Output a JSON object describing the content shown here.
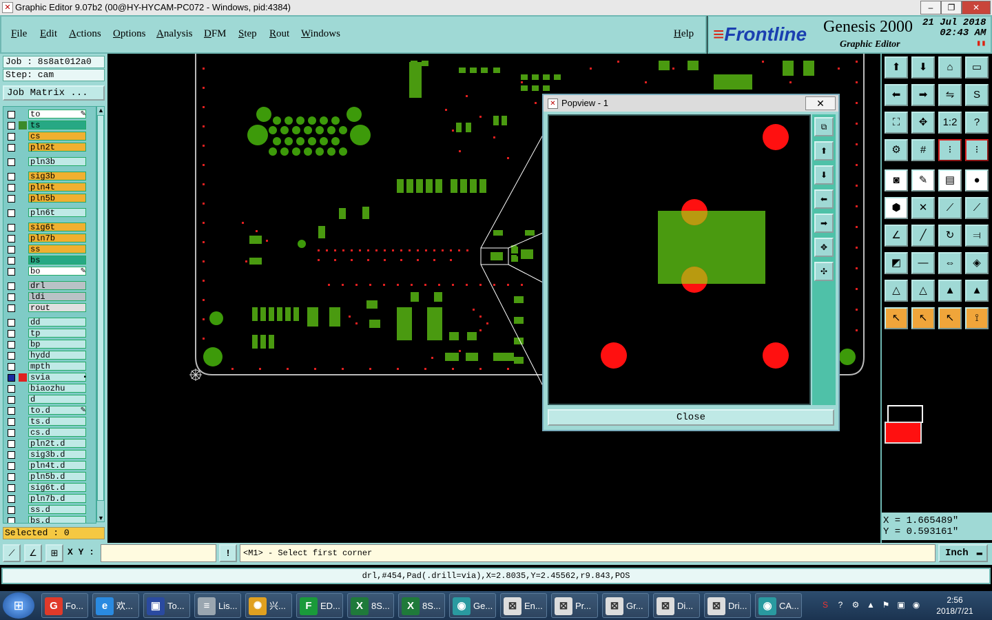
{
  "window": {
    "title": "Graphic Editor 9.07b2 (00@HY-HYCAM-PC072 - Windows, pid:4384)",
    "min": "–",
    "max": "❐",
    "close": "✕"
  },
  "menu": [
    "File",
    "Edit",
    "Actions",
    "Options",
    "Analysis",
    "DFM",
    "Step",
    "Rout",
    "Windows"
  ],
  "help": "Help",
  "brand": {
    "logo": "Frontline",
    "product": "Genesis 2000",
    "subtitle": "Graphic Editor",
    "date": "21 Jul 2018",
    "time": "02:43 AM"
  },
  "job": {
    "job": "Job : 8s8at012a0",
    "step": "Step: cam",
    "matrix": "Job Matrix ..."
  },
  "layers": [
    {
      "name": "to",
      "color": "#ffffff",
      "marker": "✎"
    },
    {
      "name": "ts",
      "color": "#27a884",
      "sw": "#3a8a2a"
    },
    {
      "name": "cs",
      "color": "#f0b030"
    },
    {
      "name": "pln2t",
      "color": "#f0b030"
    },
    {
      "name": "pln3b",
      "color": "#bfe9e6"
    },
    {
      "name": "sig3b",
      "color": "#f0b030"
    },
    {
      "name": "pln4t",
      "color": "#f0b030"
    },
    {
      "name": "pln5b",
      "color": "#f0b030"
    },
    {
      "name": "pln6t",
      "color": "#bfe9e6"
    },
    {
      "name": "sig6t",
      "color": "#f0b030"
    },
    {
      "name": "pln7b",
      "color": "#f0b030"
    },
    {
      "name": "ss",
      "color": "#f0b030"
    },
    {
      "name": "bs",
      "color": "#27a884"
    },
    {
      "name": "bo",
      "color": "#ffffff",
      "marker": "✎"
    },
    {
      "name": "drl",
      "color": "#b9c2c6"
    },
    {
      "name": "ldi",
      "color": "#b9c2c6"
    },
    {
      "name": "rout",
      "color": "#e0e0e0"
    },
    {
      "name": "dd",
      "color": "#bfe9e6"
    },
    {
      "name": "tp",
      "color": "#bfe9e6"
    },
    {
      "name": "bp",
      "color": "#bfe9e6"
    },
    {
      "name": "hydd",
      "color": "#bfe9e6"
    },
    {
      "name": "mpth",
      "color": "#bfe9e6"
    },
    {
      "name": "svia",
      "color": "#bfe9e6",
      "sw": "#e02020",
      "marker": "▪"
    },
    {
      "name": "biaozhu",
      "color": "#bfe9e6"
    },
    {
      "name": "d",
      "color": "#bfe9e6"
    },
    {
      "name": "to.d",
      "color": "#bfe9e6",
      "marker": "✎"
    },
    {
      "name": "ts.d",
      "color": "#bfe9e6"
    },
    {
      "name": "cs.d",
      "color": "#bfe9e6"
    },
    {
      "name": "pln2t.d",
      "color": "#bfe9e6"
    },
    {
      "name": "sig3b.d",
      "color": "#bfe9e6"
    },
    {
      "name": "pln4t.d",
      "color": "#bfe9e6"
    },
    {
      "name": "pln5b.d",
      "color": "#bfe9e6"
    },
    {
      "name": "sig6t.d",
      "color": "#bfe9e6"
    },
    {
      "name": "pln7b.d",
      "color": "#bfe9e6"
    },
    {
      "name": "ss.d",
      "color": "#bfe9e6"
    },
    {
      "name": "bs.d",
      "color": "#bfe9e6"
    }
  ],
  "selected": "Selected : 0",
  "popview": {
    "title": "Popview - 1",
    "close_x": "✕",
    "close_button": "Close"
  },
  "coords": {
    "x": "X = 1.665489\"",
    "y": "Y = 0.593161\""
  },
  "command": {
    "xy_label": "X Y :",
    "xy_value": "",
    "prompt": "<M1> - Select first corner",
    "unit": "Inch"
  },
  "status": "drl,#454,Pad(.drill=via),X=2.8035,Y=2.45562,r9.843,POS",
  "taskbar": {
    "tasks": [
      {
        "label": "Fo...",
        "icon": "G",
        "color": "#e03a2a"
      },
      {
        "label": "欢...",
        "icon": "e",
        "color": "#2a8ae0"
      },
      {
        "label": "To...",
        "icon": "▣",
        "color": "#2a4aa0"
      },
      {
        "label": "Lis...",
        "icon": "≡",
        "color": "#9aa6b0"
      },
      {
        "label": "兴...",
        "icon": "✺",
        "color": "#e0a020"
      },
      {
        "label": "ED...",
        "icon": "F",
        "color": "#1a9a3a"
      },
      {
        "label": "8S...",
        "icon": "X",
        "color": "#1f7a3a"
      },
      {
        "label": "8S...",
        "icon": "X",
        "color": "#1f7a3a"
      },
      {
        "label": "Ge...",
        "icon": "◉",
        "color": "#2a9aa0"
      },
      {
        "label": "En...",
        "icon": "⊠",
        "color": "#dddddd"
      },
      {
        "label": "Pr...",
        "icon": "⊠",
        "color": "#dddddd"
      },
      {
        "label": "Gr...",
        "icon": "⊠",
        "color": "#dddddd"
      },
      {
        "label": "Di...",
        "icon": "⊠",
        "color": "#dddddd"
      },
      {
        "label": "Dri...",
        "icon": "⊠",
        "color": "#dddddd"
      },
      {
        "label": "CA...",
        "icon": "◉",
        "color": "#2a9aa0"
      }
    ],
    "time": "2:56",
    "date": "2018/7/21"
  }
}
